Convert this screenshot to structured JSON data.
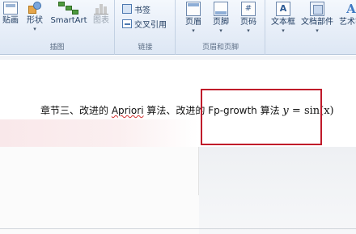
{
  "ribbon": {
    "insert_group": {
      "label": "插图",
      "buttons": [
        {
          "label": "贴画",
          "icon": "clip-art-icon"
        },
        {
          "label": "形状",
          "icon": "shapes-icon"
        },
        {
          "label": "SmartArt",
          "icon": "smartart-icon"
        },
        {
          "label": "图表",
          "icon": "chart-icon"
        }
      ]
    },
    "links_group": {
      "label": "链接",
      "bookmark": "书签",
      "cross_reference": "交叉引用"
    },
    "header_footer_group": {
      "label": "页眉和页脚",
      "buttons": [
        {
          "label": "页眉",
          "icon": "header-icon"
        },
        {
          "label": "页脚",
          "icon": "footer-icon"
        },
        {
          "label": "页码",
          "icon": "page-number-icon"
        }
      ]
    },
    "text_group": {
      "buttons": [
        {
          "label": "文本框",
          "icon": "text-box-icon"
        },
        {
          "label": "文档部件",
          "icon": "quick-parts-icon"
        },
        {
          "label": "艺术字",
          "icon": "wordart-icon"
        }
      ]
    }
  },
  "document": {
    "line_prefix": "章节三、改进的 ",
    "apriori": "Apriori",
    "line_mid": " 算法、改进的 ",
    "fp": "Fp",
    "line_growth": "-growth 算法 ",
    "formula_y": "y",
    "formula_rest": " = sin(x)"
  },
  "colors": {
    "highlight_border": "#c0192a",
    "ribbon_bg": "#e7eef8"
  }
}
